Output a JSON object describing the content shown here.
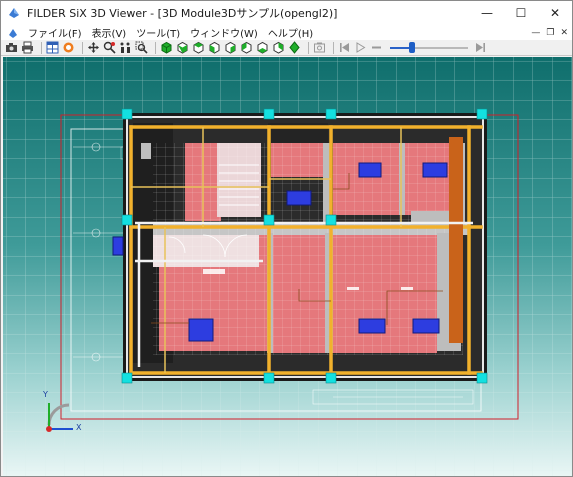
{
  "window": {
    "title": "FILDER SiX 3D Viewer - [3D Module3Dサンプル(opengl2)]",
    "controls": {
      "minimize": "—",
      "maximize": "☐",
      "close": "✕"
    }
  },
  "menu": {
    "items": [
      {
        "label": "ファイル(F)"
      },
      {
        "label": "表示(V)"
      },
      {
        "label": "ツール(T)"
      },
      {
        "label": "ウィンドウ(W)"
      },
      {
        "label": "ヘルプ(H)"
      }
    ],
    "mdi_controls": {
      "minimize": "—",
      "restore": "❐",
      "close": "✕"
    }
  },
  "toolbar": {
    "zoom_slider_level": 0.28,
    "colors": {
      "accent": "#1f5fc6",
      "green_cube": "#1fae2a"
    }
  },
  "viewport": {
    "axis": {
      "x": "X",
      "y": "Y"
    },
    "colors": {
      "background_top": "#0f6e6c",
      "background_bottom": "#e9f6f5",
      "room_fill": "#e5787c",
      "ac_unit": "#2d3de0",
      "column": "#13e0e0",
      "beam": "#f2b12c",
      "boundary": "#d11f2a"
    }
  }
}
